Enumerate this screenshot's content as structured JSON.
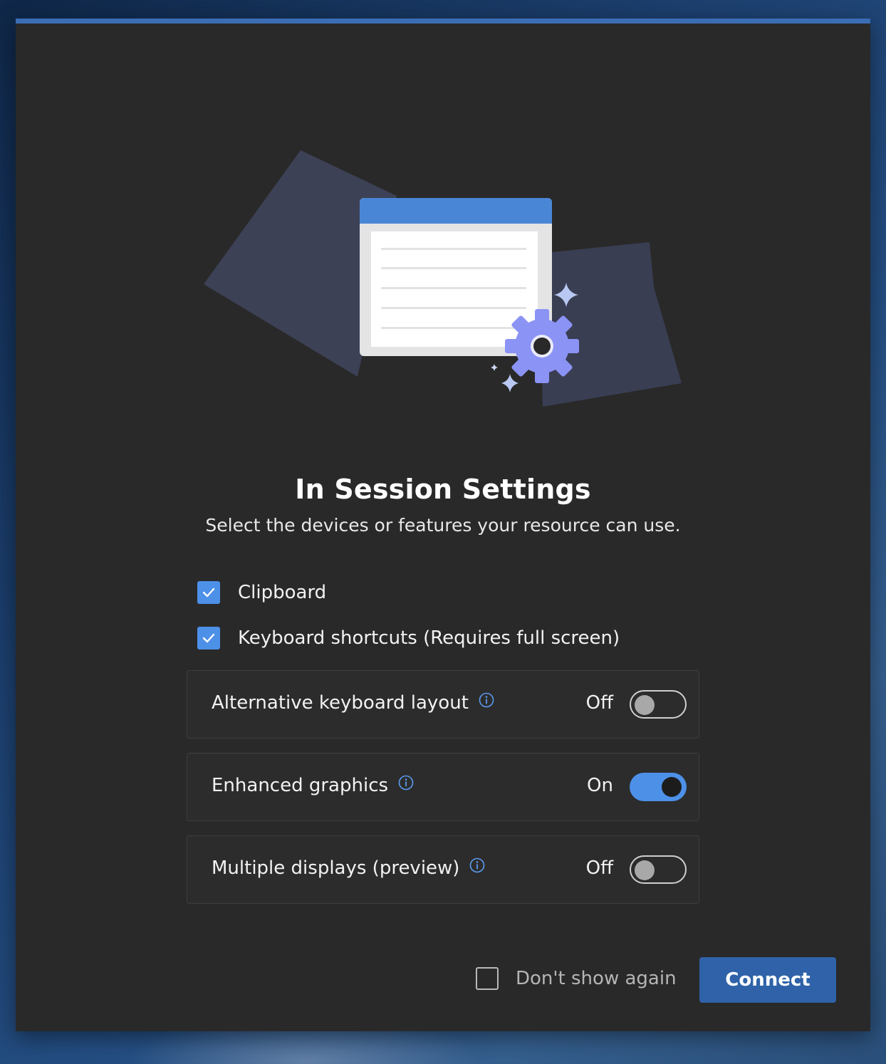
{
  "dialog": {
    "title": "In Session Settings",
    "subtitle": "Select the devices or features your resource can use."
  },
  "checkboxes": [
    {
      "label": "Clipboard",
      "checked": true
    },
    {
      "label": "Keyboard shortcuts (Requires full screen)",
      "checked": true
    }
  ],
  "settings": [
    {
      "label": "Alternative keyboard layout",
      "state": "Off",
      "on": false
    },
    {
      "label": "Enhanced graphics",
      "state": "On",
      "on": true
    },
    {
      "label": "Multiple displays (preview)",
      "state": "Off",
      "on": false
    }
  ],
  "footer": {
    "dont_show_label": "Don't show again",
    "dont_show_checked": false,
    "connect_label": "Connect"
  },
  "colors": {
    "accent": "#4d90e8",
    "button": "#2f62a8",
    "dialog_bg": "#292929",
    "gear": "#8b93f5"
  },
  "icons": {
    "illustration": "settings-window-gear-illustration",
    "info": "info-icon",
    "check": "checkmark-icon"
  }
}
